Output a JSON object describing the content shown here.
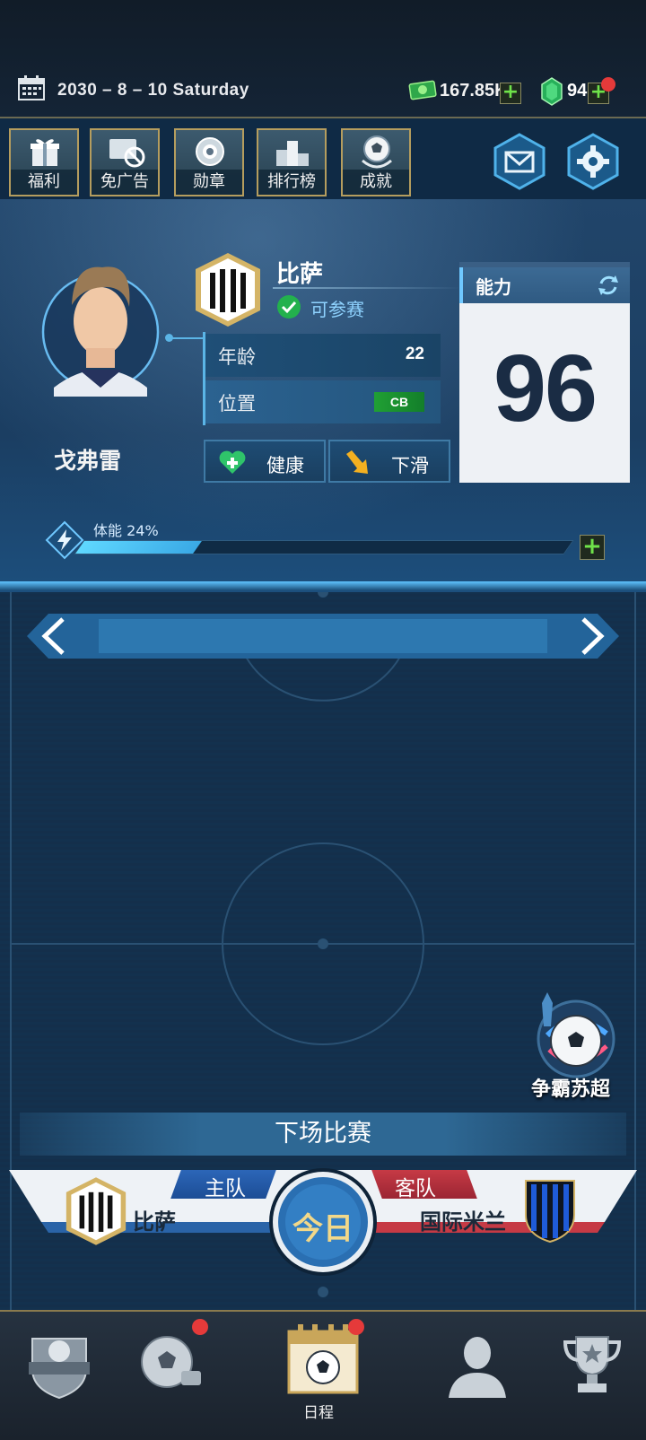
{
  "status_bar": {
    "date": "2030 – 8 – 10   Saturday",
    "cash": "167.85K",
    "gems": "94",
    "gems_has_notification": true
  },
  "feature_buttons": [
    {
      "label": "福利",
      "icon": "gift-icon"
    },
    {
      "label": "免广告",
      "icon": "no-ads-icon"
    },
    {
      "label": "勋章",
      "icon": "medal-icon"
    },
    {
      "label": "排行榜",
      "icon": "leaderboard-icon"
    },
    {
      "label": "成就",
      "icon": "achievement-icon"
    }
  ],
  "player": {
    "name": "戈弗雷",
    "club": "比萨",
    "eligibility": "可参赛",
    "age_label": "年龄",
    "age": "22",
    "position_label": "位置",
    "position": "CB",
    "health_label": "健康",
    "form_label": "下滑",
    "ability_label": "能力",
    "ability": "96",
    "stamina_label": "体能 24%",
    "stamina_percent": 24
  },
  "league": {
    "label": "争霸苏超"
  },
  "next_match": {
    "title": "下场比赛",
    "home_label": "主队",
    "away_label": "客队",
    "home_team": "比萨",
    "away_team": "国际米兰",
    "center_label": "今日"
  },
  "bottom_nav": {
    "items": [
      {
        "icon": "club-icon"
      },
      {
        "icon": "training-icon",
        "has_notification": true
      },
      {
        "icon": "schedule-icon",
        "label": "日程",
        "active": true,
        "has_notification": true
      },
      {
        "icon": "player-icon"
      },
      {
        "icon": "trophy-icon"
      }
    ],
    "schedule_label": "日程"
  },
  "colors": {
    "accent_blue": "#5bb5e6",
    "gold_border": "#b59d5e",
    "notification_red": "#e53a3a",
    "plus_green": "#6fe34a"
  }
}
